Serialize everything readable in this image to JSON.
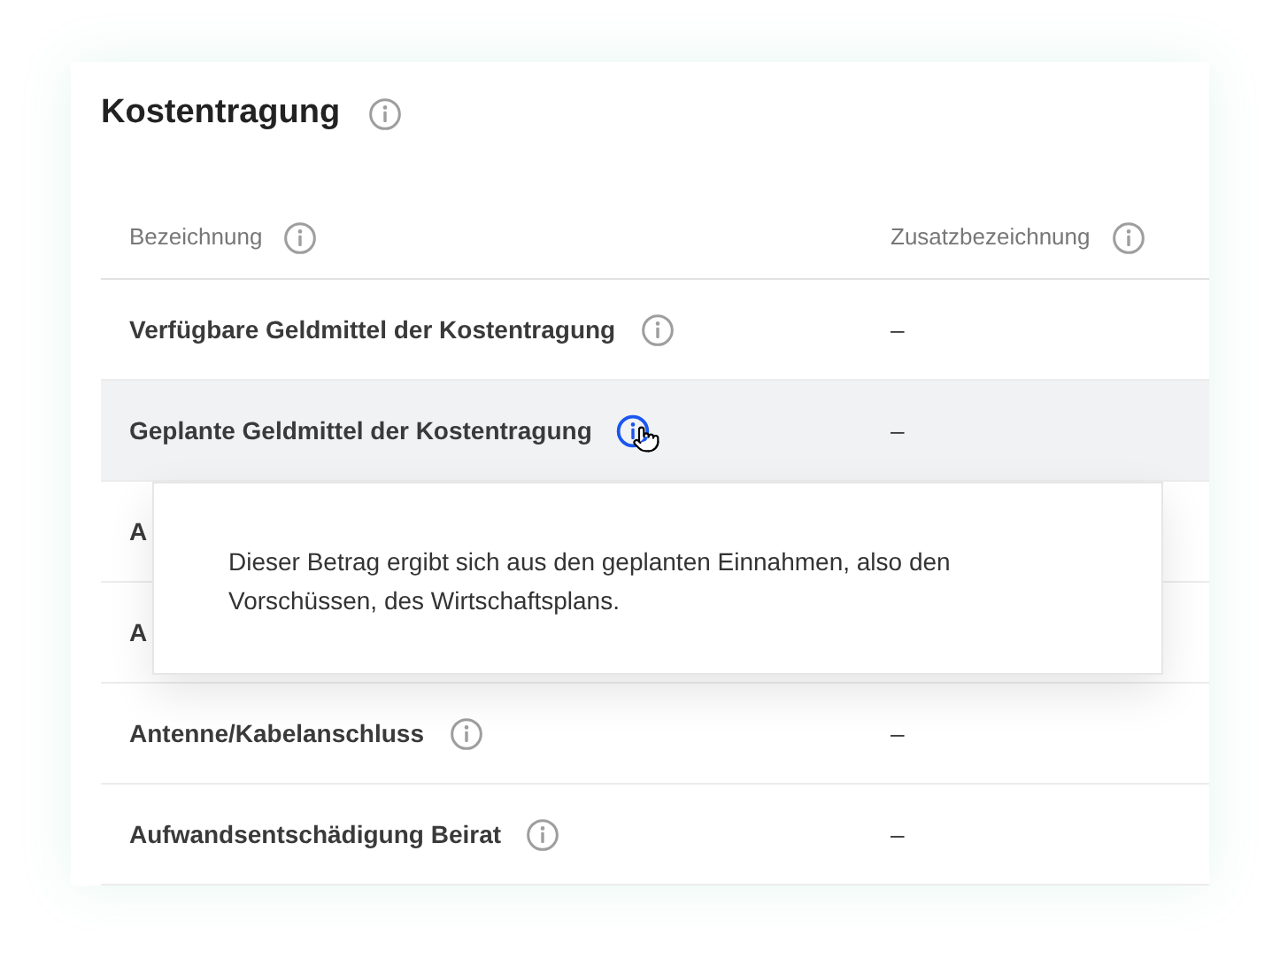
{
  "title": "Kostentragung",
  "columns": [
    "Bezeichnung",
    "Zusatzbezeichnung"
  ],
  "rows": [
    {
      "name": "Verfügbare Geldmittel der Kostentragung",
      "value": "–",
      "selected": false
    },
    {
      "name": "Geplante Geldmittel der Kostentragung",
      "value": "–",
      "selected": true
    },
    {
      "name": "A"
    },
    {
      "name": "A"
    },
    {
      "name": "Antenne/Kabelanschluss",
      "value": "–",
      "selected": false
    },
    {
      "name": "Aufwandsentschädigung Beirat",
      "value": "–",
      "selected": false
    }
  ],
  "tooltip": {
    "text": "Dieser Betrag ergibt sich aus den geplanten Einnahmen, also den Vorschüssen, des Wirtschaftsplans."
  }
}
